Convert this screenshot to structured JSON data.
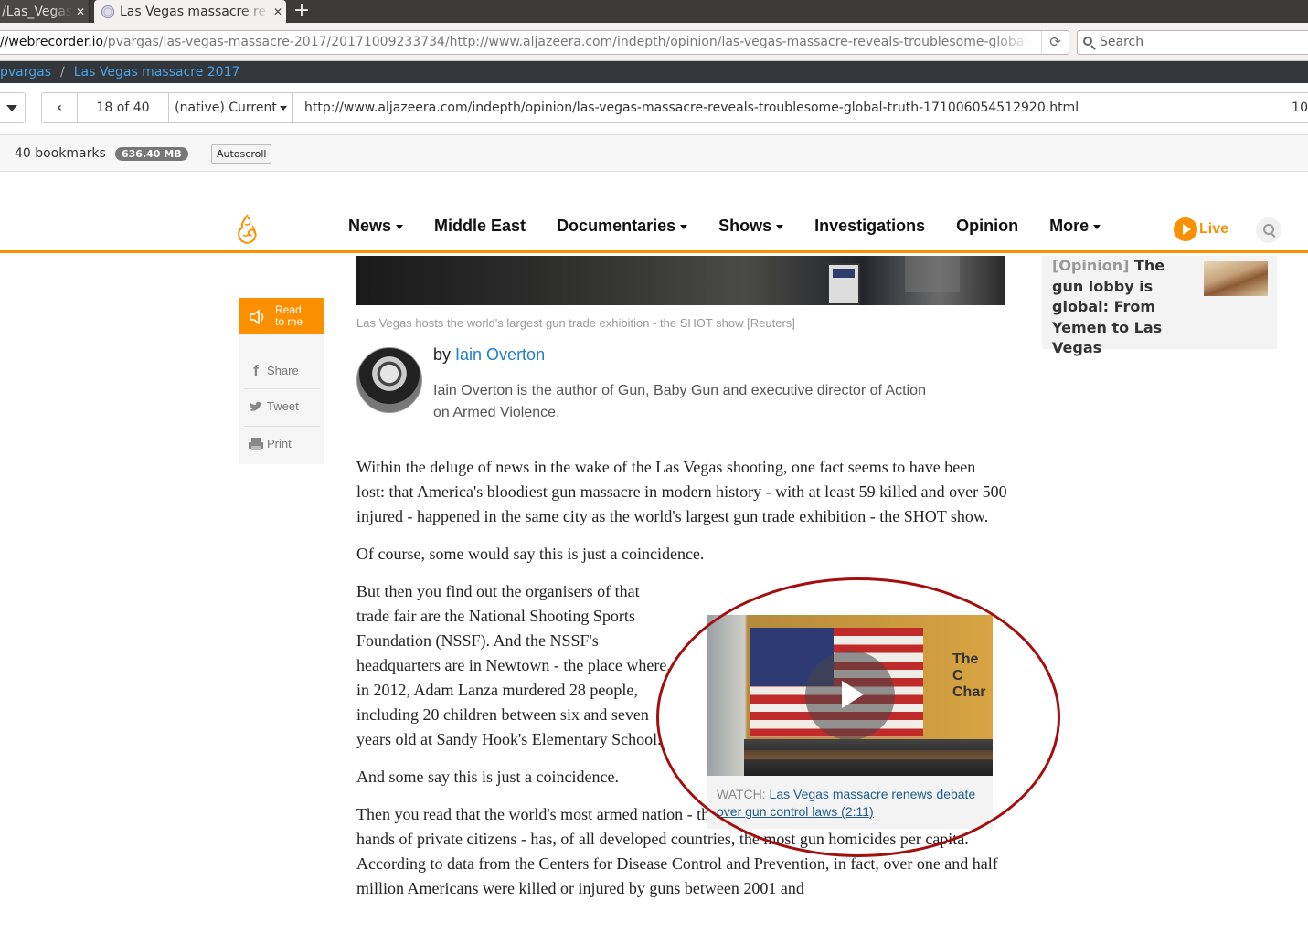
{
  "browser": {
    "tab1_title": "/Las_Vegas",
    "tab2_title": "Las Vegas massacre re",
    "url_host": "//webrecorder.io",
    "url_path": "/pvargas/las-vegas-massacre-2017/20171009233734/http://www.aljazeera.com/indepth/opinion/las-vegas-massacre-reveals-troublesome-global-t",
    "search_placeholder": "Search"
  },
  "webrecorder": {
    "breadcrumb_user": "pvargas",
    "breadcrumb_sep": "/",
    "breadcrumb_collection": "Las Vegas massacre 2017",
    "page_count": "18 of 40",
    "mode_label": "(native) Current",
    "current_url": "http://www.aljazeera.com/indepth/opinion/las-vegas-massacre-reveals-troublesome-global-truth-171006054512920.html",
    "url_overflow": "10",
    "bookmarks": "40 bookmarks",
    "size": "636.40 MB",
    "autoscroll": "Autoscroll"
  },
  "site": {
    "nav": [
      {
        "label": "News",
        "dropdown": true
      },
      {
        "label": "Middle East",
        "dropdown": false
      },
      {
        "label": "Documentaries",
        "dropdown": true
      },
      {
        "label": "Shows",
        "dropdown": true
      },
      {
        "label": "Investigations",
        "dropdown": false
      },
      {
        "label": "Opinion",
        "dropdown": false
      },
      {
        "label": "More",
        "dropdown": true
      }
    ],
    "live_label": "Live",
    "accent_color": "#fa9000"
  },
  "article": {
    "image_caption": "Las Vegas hosts the world's largest gun trade exhibition - the SHOT show [Reuters]",
    "byline_prefix": "by",
    "author_name": "Iain Overton",
    "author_bio": "Iain Overton is the author of Gun, Baby Gun and executive director of Action on Armed Violence.",
    "paragraphs": [
      "Within the deluge of news in the wake of the Las Vegas shooting, one fact seems to have been lost: that America's bloodiest gun massacre in modern history - with at least 59 killed and over 500 injured - happened in the same city as the world's largest gun trade exhibition - the SHOT show.",
      "Of course, some would say this is just a coincidence.",
      "But then you find out the organisers of that trade fair are the National Shooting Sports Foundation (NSSF). And the NSSF's headquarters are in Newtown - the place where, in 2012, Adam Lanza murdered 28 people, including 20 children between six and seven years old at Sandy Hook's Elementary School.",
      "And some say this is just a coincidence.",
      "Then you read that the world's most armed nation - the US, with about 300 million guns in the hands of private citizens - has, of all developed countries, the most gun homicides per capita. According to data from the Centers for Disease Control and Prevention, in fact, over one and half million Americans were killed or injured by guns between 2001 and"
    ],
    "video": {
      "watch_label": "WATCH:",
      "link_text": "Las Vegas massacre renews debate over gun control laws (2:11)",
      "sign_text_1": "The C",
      "sign_text_2": "Char"
    }
  },
  "share": {
    "read_line1": "Read",
    "read_line2": "to me",
    "share_label": "Share",
    "tweet_label": "Tweet",
    "print_label": "Print"
  },
  "sidebar": {
    "tag": "[Opinion]",
    "title": "The gun lobby is global: From Yemen to Las Vegas"
  }
}
